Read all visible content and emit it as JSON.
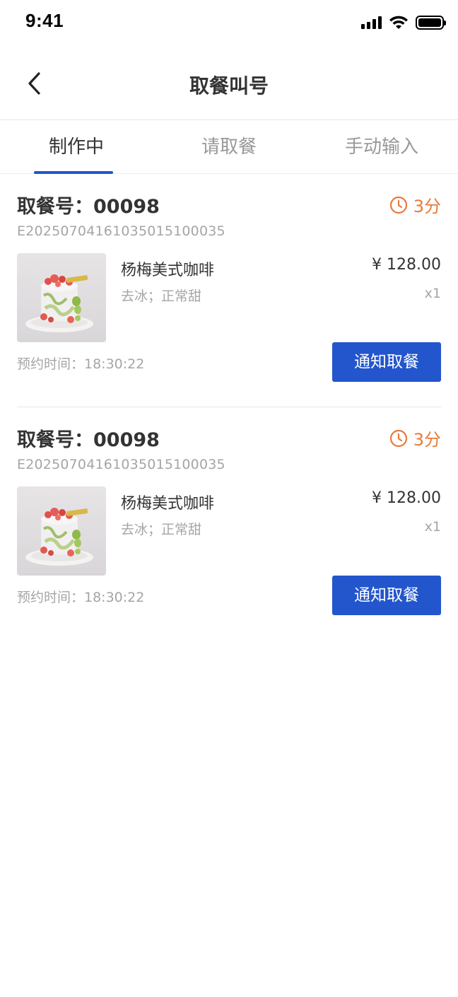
{
  "status_bar": {
    "time": "9:41",
    "icons": [
      "signal-icon",
      "wifi-icon",
      "battery-icon"
    ]
  },
  "nav": {
    "title": "取餐叫号",
    "back_icon": "chevron-left-icon"
  },
  "tabs": [
    {
      "label": "制作中",
      "active": true
    },
    {
      "label": "请取餐",
      "active": false
    },
    {
      "label": "手动输入",
      "active": false
    }
  ],
  "orders": [
    {
      "pickup_label": "取餐号：00098",
      "timer_icon": "clock-icon",
      "timer": "3分",
      "order_no": "E20250704161035015100035",
      "product": {
        "name": "杨梅美式咖啡",
        "spec": "去冰；正常甜",
        "price": "¥ 128.00",
        "qty": "x1"
      },
      "reserve_time": "预约时间：18:30:22",
      "notify_button": "通知取餐"
    },
    {
      "pickup_label": "取餐号：00098",
      "timer_icon": "clock-icon",
      "timer": "3分",
      "order_no": "E20250704161035015100035",
      "product": {
        "name": "杨梅美式咖啡",
        "spec": "去冰；正常甜",
        "price": "¥ 128.00",
        "qty": "x1"
      },
      "reserve_time": "预约时间：18:30:22",
      "notify_button": "通知取餐"
    }
  ],
  "colors": {
    "primary": "#2356cc",
    "timer": "#e87a3a",
    "text": "#333333",
    "muted": "#a5a5a5"
  }
}
